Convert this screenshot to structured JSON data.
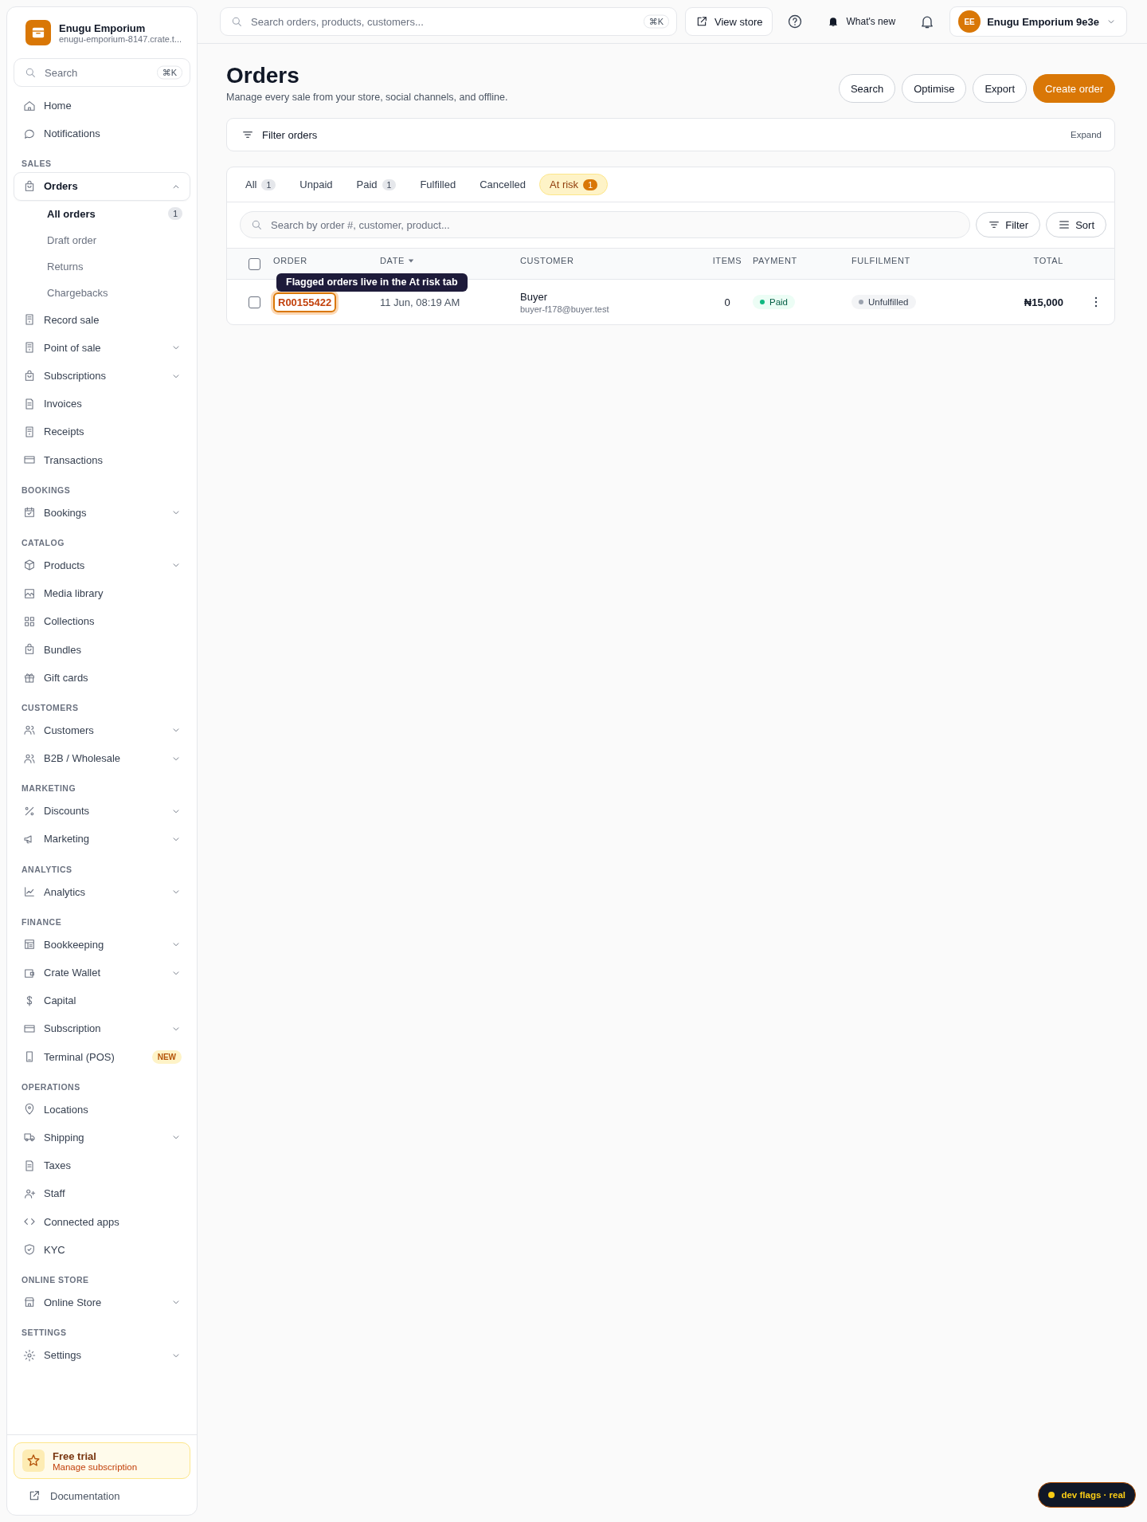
{
  "store": {
    "name": "Enugu Emporium",
    "url": "enugu-emporium-8147.crate.t..."
  },
  "sidebar": {
    "search": {
      "placeholder": "Search",
      "shortcut": "⌘K"
    },
    "sections": [
      {
        "items": [
          {
            "label": "Home",
            "selected": false
          },
          {
            "label": "Notifications",
            "selected": false
          }
        ]
      },
      {
        "label": "SALES",
        "items": [
          {
            "label": "Orders",
            "expanded": true,
            "selected": true,
            "children": [
              {
                "label": "All orders",
                "selected": true,
                "count": "1"
              },
              {
                "label": "Draft order",
                "selected": false
              },
              {
                "label": "Returns",
                "selected": false
              },
              {
                "label": "Chargebacks",
                "selected": false
              }
            ]
          },
          {
            "label": "Record sale",
            "selected": false
          },
          {
            "label": "Point of sale",
            "expanded": false,
            "selected": false
          },
          {
            "label": "Subscriptions",
            "expanded": false,
            "selected": false
          },
          {
            "label": "Invoices",
            "selected": false
          },
          {
            "label": "Receipts",
            "selected": false
          },
          {
            "label": "Transactions",
            "selected": false
          }
        ]
      },
      {
        "label": "BOOKINGS",
        "items": [
          {
            "label": "Bookings",
            "expanded": false,
            "selected": false
          }
        ]
      },
      {
        "label": "CATALOG",
        "items": [
          {
            "label": "Products",
            "expanded": false,
            "selected": false
          },
          {
            "label": "Media library",
            "selected": false
          },
          {
            "label": "Collections",
            "selected": false
          },
          {
            "label": "Bundles",
            "selected": false
          },
          {
            "label": "Gift cards",
            "selected": false
          }
        ]
      },
      {
        "label": "CUSTOMERS",
        "items": [
          {
            "label": "Customers",
            "expanded": false,
            "selected": false
          },
          {
            "label": "B2B / Wholesale",
            "expanded": false,
            "selected": false
          }
        ]
      },
      {
        "label": "MARKETING",
        "items": [
          {
            "label": "Discounts",
            "expanded": false,
            "selected": false
          },
          {
            "label": "Marketing",
            "expanded": false,
            "selected": false
          }
        ]
      },
      {
        "label": "ANALYTICS",
        "items": [
          {
            "label": "Analytics",
            "expanded": false,
            "selected": false
          }
        ]
      },
      {
        "label": "FINANCE",
        "items": [
          {
            "label": "Bookkeeping",
            "expanded": false,
            "selected": false
          },
          {
            "label": "Crate Wallet",
            "expanded": false,
            "selected": false
          },
          {
            "label": "Capital",
            "selected": false
          },
          {
            "label": "Subscription",
            "expanded": false,
            "selected": false
          },
          {
            "label": "Terminal (POS)",
            "selected": false,
            "badge": "NEW"
          }
        ]
      },
      {
        "label": "OPERATIONS",
        "items": [
          {
            "label": "Locations",
            "selected": false
          },
          {
            "label": "Shipping",
            "expanded": false,
            "selected": false
          },
          {
            "label": "Taxes",
            "selected": false
          },
          {
            "label": "Staff",
            "selected": false
          },
          {
            "label": "Connected apps",
            "selected": false
          },
          {
            "label": "KYC",
            "selected": false
          }
        ]
      },
      {
        "label": "ONLINE STORE",
        "items": [
          {
            "label": "Online Store",
            "expanded": false,
            "selected": false
          }
        ]
      },
      {
        "label": "SETTINGS",
        "items": [
          {
            "label": "Settings",
            "expanded": false,
            "selected": false
          }
        ]
      }
    ],
    "trial": {
      "title": "Free trial",
      "subtitle": "Manage subscription"
    },
    "documentation": "Documentation"
  },
  "topbar": {
    "search": {
      "placeholder": "Search orders, products, customers...",
      "shortcut": "⌘K"
    },
    "view_store": "View store",
    "whats_new": "What's new",
    "account": {
      "initials": "EE",
      "name": "Enugu Emporium 9e3e"
    }
  },
  "page": {
    "title": "Orders",
    "subtitle": "Manage every sale from your store, social channels, and offline.",
    "actions": [
      {
        "label": "Search",
        "primary": false
      },
      {
        "label": "Optimise",
        "primary": false
      },
      {
        "label": "Export",
        "primary": false
      },
      {
        "label": "Create order",
        "primary": true
      }
    ]
  },
  "filter_panel": {
    "label": "Filter orders",
    "expand": "Expand"
  },
  "tabs": [
    {
      "label": "All",
      "count": "1",
      "selected": false
    },
    {
      "label": "Unpaid",
      "selected": false
    },
    {
      "label": "Paid",
      "count": "1",
      "selected": false
    },
    {
      "label": "Fulfilled",
      "selected": false
    },
    {
      "label": "Cancelled",
      "selected": false
    },
    {
      "label": "At risk",
      "count": "1",
      "selected": true
    }
  ],
  "table": {
    "search": {
      "placeholder": "Search by order #, customer, product..."
    },
    "filter": "Filter",
    "sort": "Sort",
    "select_all": {
      "checked": false
    },
    "columns": [
      {
        "label": "ORDER",
        "sorted": false
      },
      {
        "label": "DATE",
        "sorted": true
      },
      {
        "label": "CUSTOMER",
        "sorted": false
      },
      {
        "label": "ITEMS",
        "sorted": false
      },
      {
        "label": "PAYMENT",
        "sorted": false
      },
      {
        "label": "FULFILMENT",
        "sorted": false
      },
      {
        "label": "TOTAL",
        "sorted": false
      }
    ],
    "rows": [
      {
        "checked": false,
        "order": "R00155422",
        "highlighted": true,
        "date": "11 Jun, 08:19 AM",
        "customer": "Buyer",
        "email": "buyer-f178@buyer.test",
        "items": "0",
        "payment": {
          "label": "Paid",
          "color": "#10b981"
        },
        "fulfilment": {
          "label": "Unfulfilled",
          "color": "#9ca3af"
        },
        "total": "₦15,000"
      }
    ],
    "tooltip": "Flagged orders live in the At risk tab"
  },
  "dev_badge": "dev flags · real"
}
